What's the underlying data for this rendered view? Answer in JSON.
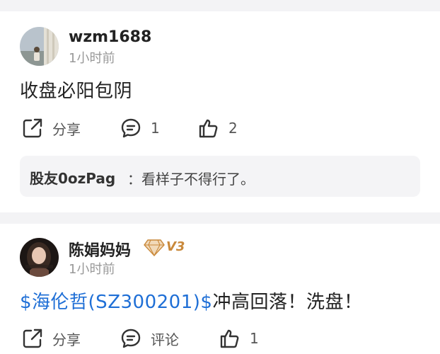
{
  "posts": [
    {
      "username": "wzm1688",
      "time": "1小时前",
      "content": "收盘必阳包阴",
      "share_label": "分享",
      "comment_label": "1",
      "like_label": "2",
      "reply": {
        "user": "股友0ozPag",
        "text": "：看样子不得行了。"
      }
    },
    {
      "username": "陈娟妈妈",
      "badge": "V3",
      "time": "1小时前",
      "content_stock": "$海伦哲(SZ300201)$",
      "content_text": "冲高回落！洗盘！",
      "share_label": "分享",
      "comment_label": "评论",
      "like_label": "1"
    }
  ],
  "colors": {
    "stock_link": "#1f6fd6",
    "badge": "#c9893b",
    "muted": "#999999"
  }
}
